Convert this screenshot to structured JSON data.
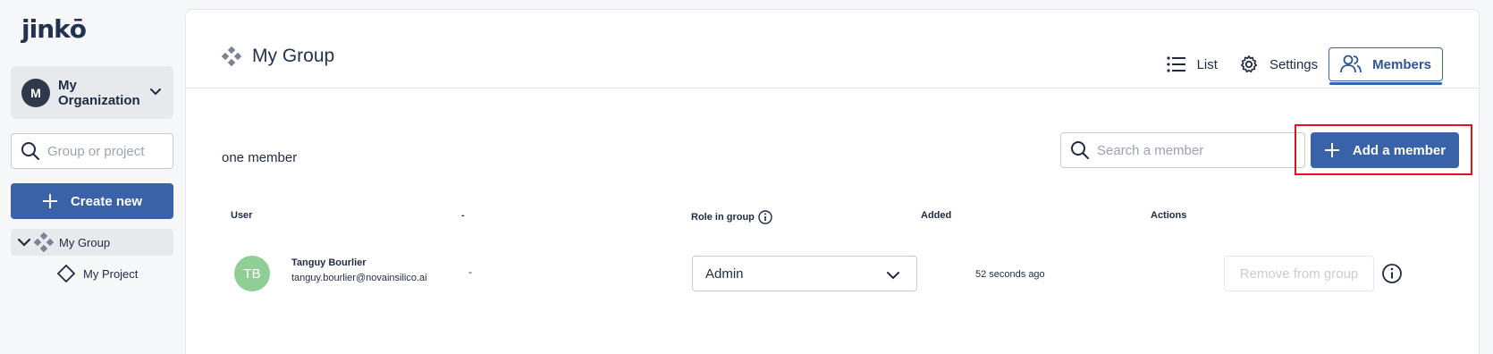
{
  "sidebar": {
    "logo": "jinkō",
    "org": {
      "initial": "M",
      "name": "My Organization"
    },
    "search_placeholder": "Group or project",
    "create_label": "Create new",
    "tree": {
      "group_label": "My Group",
      "project_label": "My Project"
    }
  },
  "header": {
    "title": "My Group",
    "tabs": [
      {
        "label": "List",
        "icon": "list-icon",
        "active": false
      },
      {
        "label": "Settings",
        "icon": "gear-icon",
        "active": false
      },
      {
        "label": "Members",
        "icon": "users-icon",
        "active": true
      }
    ]
  },
  "members": {
    "count_text": "one member",
    "search_placeholder": "Search a member",
    "add_label": "Add a member",
    "columns": {
      "user": "User",
      "dash": "-",
      "role": "Role in group",
      "added": "Added",
      "actions": "Actions"
    },
    "rows": [
      {
        "initials": "TB",
        "name": "Tanguy Bourlier",
        "email": "tanguy.bourlier@novainsilico.ai",
        "dash": "-",
        "role": "Admin",
        "added": "52 seconds ago",
        "remove_label": "Remove from group"
      }
    ]
  },
  "colors": {
    "primary": "#3a62a8",
    "highlight": "#e0141b",
    "avatar_green": "#8fcf95",
    "text": "#1f2a44"
  }
}
